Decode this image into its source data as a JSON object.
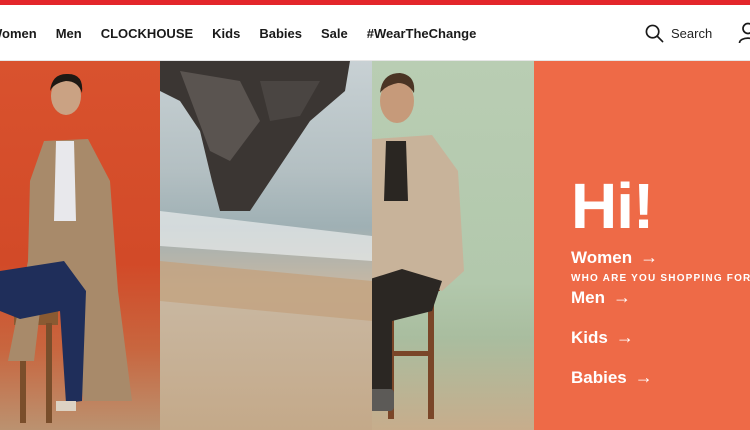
{
  "nav": {
    "items": [
      {
        "label": "Women"
      },
      {
        "label": "Men"
      },
      {
        "label": "CLOCKHOUSE"
      },
      {
        "label": "Kids"
      },
      {
        "label": "Babies"
      },
      {
        "label": "Sale"
      },
      {
        "label": "#WearTheChange"
      }
    ]
  },
  "search": {
    "label": "Search",
    "icon": "search-icon"
  },
  "account": {
    "icon": "user-icon"
  },
  "colors": {
    "brand_red": "#e3262b",
    "cta_orange": "#ee6a47"
  },
  "hero": {
    "greeting": "Hi!",
    "question": "WHO ARE YOU SHOPPING FOR",
    "options": [
      {
        "label": "Women",
        "arrow": "→"
      },
      {
        "label": "Men",
        "arrow": "→"
      },
      {
        "label": "Kids",
        "arrow": "→"
      },
      {
        "label": "Babies",
        "arrow": "→"
      }
    ]
  }
}
